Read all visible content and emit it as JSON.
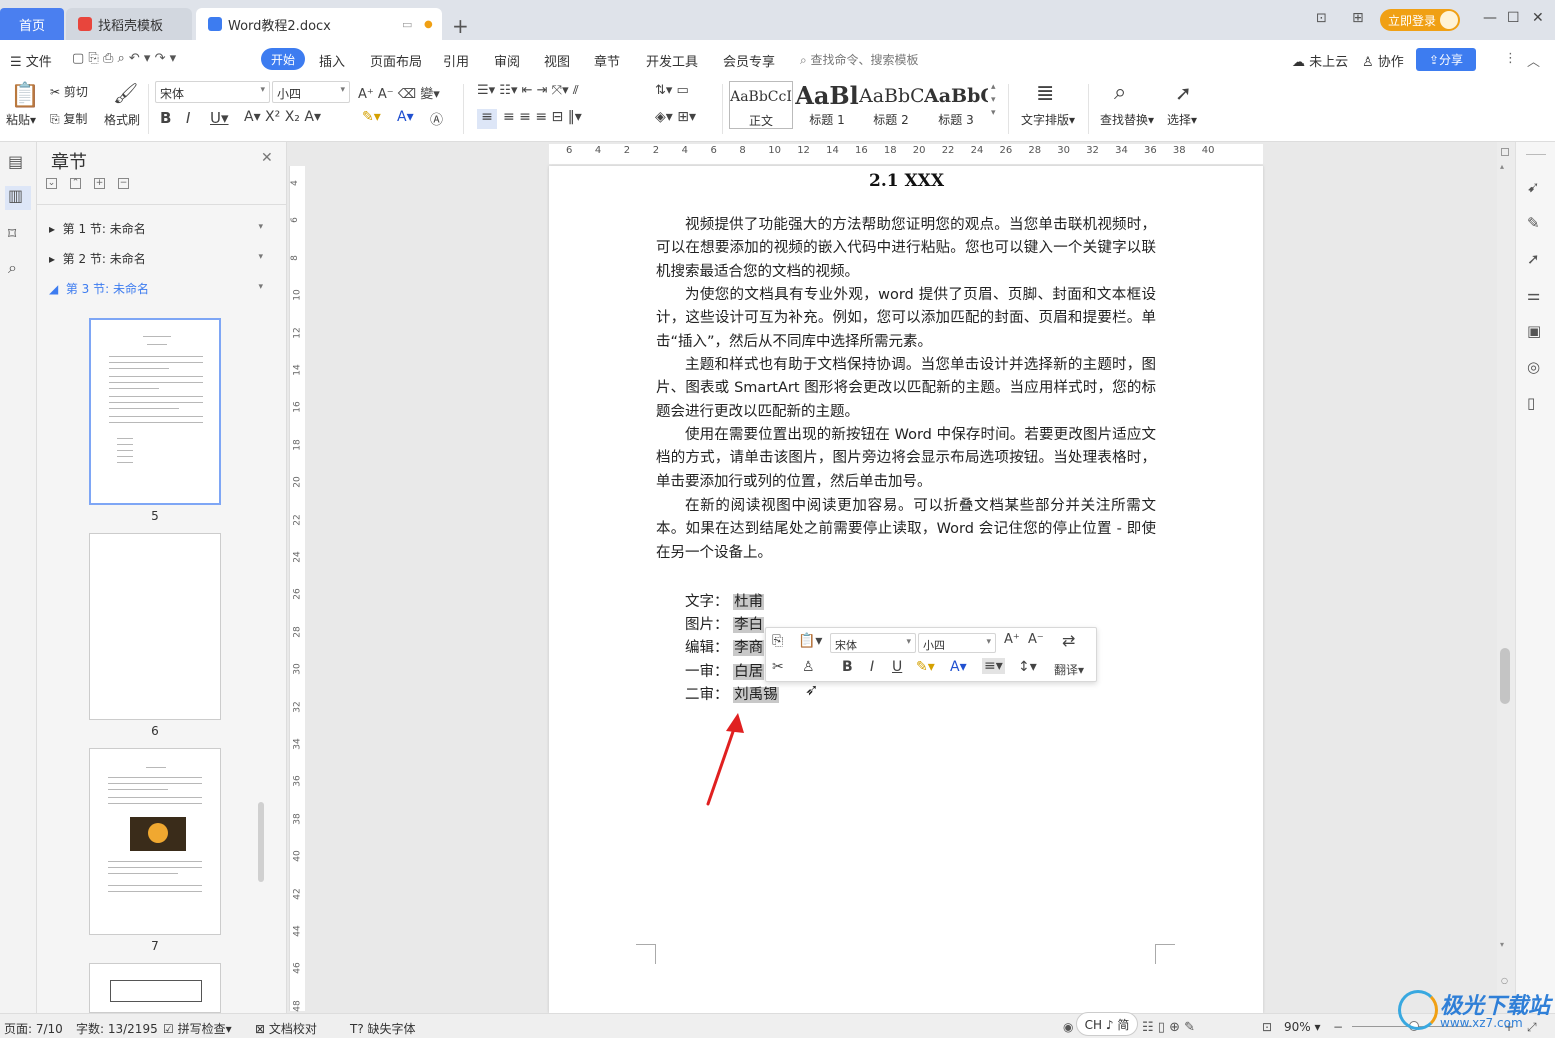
{
  "tabs": {
    "home": "首页",
    "templates": "找稻壳模板",
    "doc": "Word教程2.docx"
  },
  "window": {
    "login": "立即登录"
  },
  "menu": {
    "file": "文件",
    "start": "开始",
    "insert": "插入",
    "layout": "页面布局",
    "references": "引用",
    "review": "审阅",
    "view": "视图",
    "chapter": "章节",
    "devtools": "开发工具",
    "member": "会员专享",
    "search_placeholder": "查找命令、搜索模板",
    "cloud": "未上云",
    "collab": "协作",
    "share": "分享"
  },
  "ribbon": {
    "paste": "粘贴",
    "cut": "剪切",
    "copy": "复制",
    "format_painter": "格式刷",
    "font_name": "宋体",
    "font_size": "小四",
    "styles": [
      {
        "sample": "AaBbCcI",
        "name": "正文"
      },
      {
        "sample": "AaBl",
        "name": "标题 1"
      },
      {
        "sample": "AaBbC",
        "name": "标题 2"
      },
      {
        "sample": "AaBbC",
        "name": "标题 3"
      }
    ],
    "text_layout": "文字排版",
    "find_replace": "查找替换",
    "select": "选择"
  },
  "pane": {
    "title": "章节",
    "sections": [
      "第 1 节: 未命名",
      "第 2 节: 未命名",
      "第 3 节: 未命名"
    ],
    "thumb_nums": [
      "5",
      "6",
      "7"
    ]
  },
  "ruler_h": [
    "6",
    "4",
    "2",
    "2",
    "4",
    "6",
    "8",
    "10",
    "12",
    "14",
    "16",
    "18",
    "20",
    "22",
    "24",
    "26",
    "28",
    "30",
    "32",
    "34",
    "36",
    "38",
    "40"
  ],
  "ruler_v": [
    "4",
    "6",
    "8",
    "10",
    "12",
    "14",
    "16",
    "18",
    "20",
    "22",
    "24",
    "26",
    "28",
    "30",
    "32",
    "34",
    "36",
    "38",
    "40",
    "42",
    "44",
    "46",
    "48"
  ],
  "document": {
    "heading": "2.1 XXX",
    "paragraphs": [
      "视频提供了功能强大的方法帮助您证明您的观点。当您单击联机视频时，可以在想要添加的视频的嵌入代码中进行粘贴。您也可以键入一个关键字以联机搜索最适合您的文档的视频。",
      "为使您的文档具有专业外观，word 提供了页眉、页脚、封面和文本框设计，这些设计可互为补充。例如，您可以添加匹配的封面、页眉和提要栏。单击“插入”，然后从不同库中选择所需元素。",
      "主题和样式也有助于文档保持协调。当您单击设计并选择新的主题时，图片、图表或 SmartArt 图形将会更改以匹配新的主题。当应用样式时，您的标题会进行更改以匹配新的主题。",
      "使用在需要位置出现的新按钮在 Word 中保存时间。若要更改图片适应文档的方式，请单击该图片，图片旁边将会显示布局选项按钮。当处理表格时，单击要添加行或列的位置，然后单击加号。",
      "在新的阅读视图中阅读更加容易。可以折叠文档某些部分并关注所需文本。如果在达到结尾处之前需要停止读取，Word 会记住您的停止位置 - 即使在另一个设备上。"
    ],
    "credits": [
      {
        "label": "文字：",
        "value": "杜甫"
      },
      {
        "label": "图片：",
        "value": "李白"
      },
      {
        "label": "编辑：",
        "value": "李商"
      },
      {
        "label": "一审：",
        "value": "白居"
      },
      {
        "label": "二审：",
        "value": "刘禹锡"
      }
    ]
  },
  "minibar": {
    "font_name": "宋体",
    "font_size": "小四",
    "translate": "翻译"
  },
  "status": {
    "page": "页面: 7/10",
    "words": "字数: 13/2195",
    "spell": "拼写检查",
    "proof": "文档校对",
    "missing_font": "缺失字体",
    "ime": "CH ♪ 简",
    "zoom": "90%"
  },
  "watermark": {
    "name": "极光下载站",
    "url": "www.xz7.com"
  },
  "colors": {
    "accent": "#3d7cf0",
    "login": "#f0a014",
    "arrow": "#e02020"
  }
}
